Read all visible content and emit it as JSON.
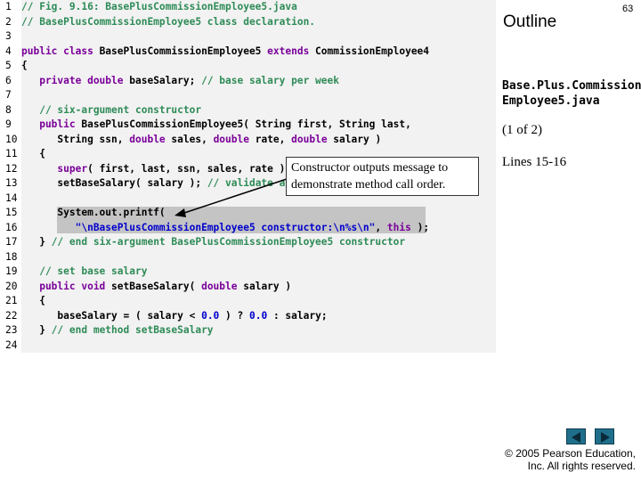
{
  "outline": {
    "title": "Outline",
    "page_number": "63"
  },
  "file_name_line1": "Base.Plus.Commission",
  "file_name_line2": "Employee5.java",
  "part_label": "(1 of 2)",
  "lines_label": "Lines 15-16",
  "callout_text": "Constructor outputs message to demonstrate method call order.",
  "copyright_line1": "© 2005 Pearson Education,",
  "copyright_line2": "Inc.  All rights reserved.",
  "navigation": {
    "prev": "previous-slide",
    "next": "next-slide"
  },
  "code_lines": [
    "1",
    "2",
    "3",
    "4",
    "5",
    "6",
    "7",
    "8",
    "9",
    "10",
    "11",
    "12",
    "13",
    "14",
    "15",
    "16",
    "17",
    "18",
    "19",
    "20",
    "21",
    "22",
    "23",
    "24"
  ],
  "code": {
    "l1": "// Fig. 9.16: BasePlusCommissionEmployee5.java",
    "l2": "// BasePlusCommissionEmployee5 class declaration.",
    "l4a": "public class",
    "l4b": " BasePlusCommissionEmployee5 ",
    "l4c": "extends",
    "l4d": " CommissionEmployee4",
    "l5": "{",
    "l6a": "   private double",
    "l6b": " baseSalary; ",
    "l6c": "// base salary per week",
    "l8": "   // six-argument constructor",
    "l9a": "   public",
    "l9b": " BasePlusCommissionEmployee5( String first, String last,",
    "l10a": "      String ssn, ",
    "l10b": "double",
    "l10c": " sales, ",
    "l10d": "double",
    "l10e": " rate, ",
    "l10f": "double",
    "l10g": " salary )",
    "l11": "   {",
    "l12a": "      super",
    "l12b": "( first, last, ssn, sales, rate );",
    "l13a": "      setBaseSalary( salary ); ",
    "l13b": "// validate and store base salary",
    "l15": "      System.out.printf(",
    "l16a": "         \"\\nBasePlusCommissionEmployee5 constructor:\\n%s\\n\"",
    "l16b": ", ",
    "l16c": "this",
    "l16d": " );",
    "l17a": "   } ",
    "l17b": "// end six-argument BasePlusCommissionEmployee5 constructor",
    "l19": "   // set base salary",
    "l20a": "   public void",
    "l20b": " setBaseSalary( ",
    "l20c": "double",
    "l20d": " salary )",
    "l21": "   {",
    "l22a": "      baseSalary = ( salary < ",
    "l22b": "0.0",
    "l22c": " ) ? ",
    "l22d": "0.0",
    "l22e": " : salary;",
    "l23a": "   } ",
    "l23b": "// end method setBaseSalary"
  }
}
